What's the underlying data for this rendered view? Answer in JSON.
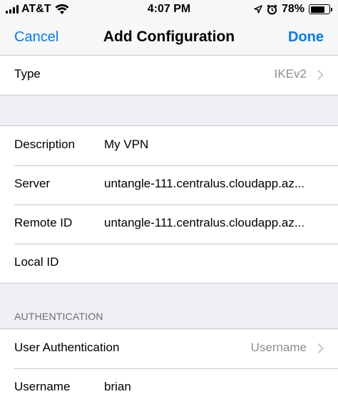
{
  "status_bar": {
    "carrier": "AT&T",
    "time": "4:07 PM",
    "battery_percent": "78%",
    "battery_level": 0.78,
    "icons": [
      "signal-icon",
      "wifi-icon",
      "location-icon",
      "alarm-icon",
      "battery-icon"
    ]
  },
  "nav": {
    "cancel_label": "Cancel",
    "title": "Add Configuration",
    "done_label": "Done"
  },
  "type_row": {
    "label": "Type",
    "value": "IKEv2",
    "icon": "chevron-right-icon"
  },
  "config": {
    "description_label": "Description",
    "description_value": "My VPN",
    "server_label": "Server",
    "server_value": "untangle-111.centralus.cloudapp.az...",
    "remote_id_label": "Remote ID",
    "remote_id_value": "untangle-111.centralus.cloudapp.az...",
    "local_id_label": "Local ID",
    "local_id_value": ""
  },
  "authentication": {
    "header": "AUTHENTICATION",
    "user_auth_label": "User Authentication",
    "user_auth_value": "Username",
    "username_label": "Username",
    "username_value": "brian"
  },
  "colors": {
    "accent": "#007aff",
    "background": "#efeff4",
    "separator": "#c8c7cc",
    "secondary_text": "#8e8e93"
  }
}
